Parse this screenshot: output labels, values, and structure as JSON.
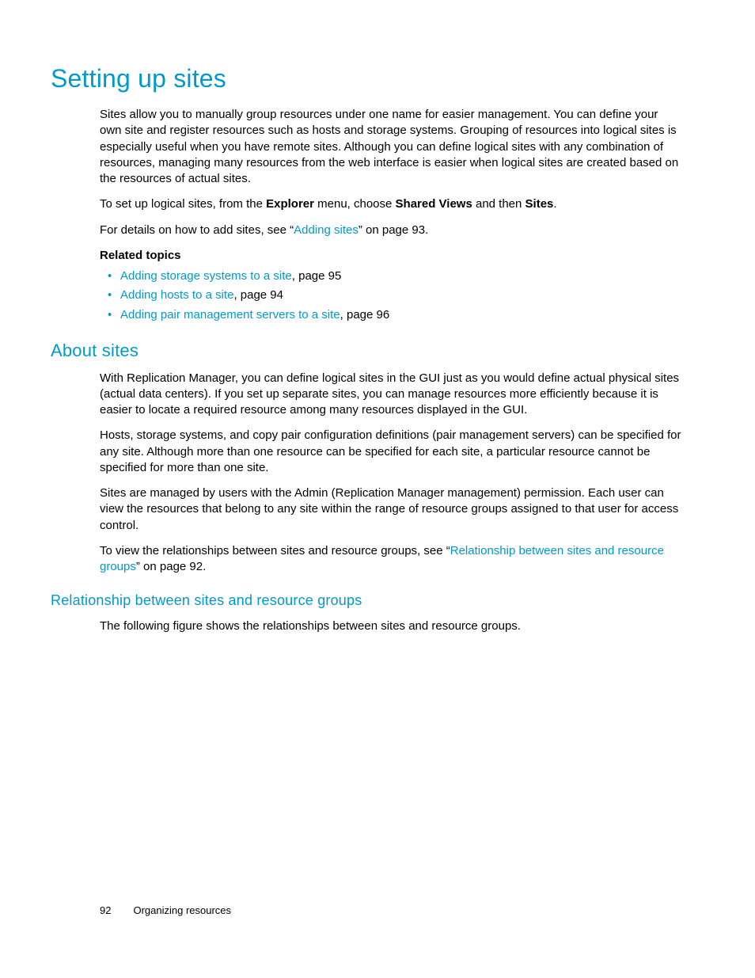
{
  "h1": "Setting up sites",
  "p1_a": "Sites allow you to manually group resources under one name for easier management. You can define your own site and register resources such as hosts and storage systems. Grouping of resources into logical sites is especially useful when you have remote sites. Although you can define logical sites with any combination of resources, managing many resources from the web interface is easier when logical sites are created based on the resources of actual sites.",
  "p2_pre": "To set up logical sites, from the ",
  "p2_b1": "Explorer",
  "p2_mid1": " menu, choose ",
  "p2_b2": "Shared Views",
  "p2_mid2": " and then ",
  "p2_b3": "Sites",
  "p2_end": ".",
  "p3_pre": " For details on how to add sites, see “",
  "p3_link": "Adding sites",
  "p3_post": "” on page 93.",
  "related_heading": "Related topics",
  "rt": [
    {
      "link": "Adding storage systems to a site",
      "rest": ", page 95"
    },
    {
      "link": "Adding hosts to a site",
      "rest": ", page 94"
    },
    {
      "link": "Adding pair management servers to a site",
      "rest": ", page 96"
    }
  ],
  "h2": "About sites",
  "a1": "With Replication Manager, you can define logical sites in the GUI just as you would define actual physical sites (actual data centers). If you set up separate sites, you can manage resources more efficiently because it is easier to locate a required resource among many resources displayed in the GUI.",
  "a2": "Hosts, storage systems, and copy pair configuration definitions (pair management servers) can be specified for any site. Although more than one resource can be specified for each site, a particular resource cannot be specified for more than one site.",
  "a3": "Sites are managed by users with the Admin (Replication Manager management) permission. Each user can view the resources that belong to any site within the range of resource groups assigned to that user for access control.",
  "a4_pre": "To view the relationships between sites and resource groups, see “",
  "a4_link": "Relationship between sites and resource groups",
  "a4_post": "” on page 92.",
  "h3": "Relationship between sites and resource groups",
  "r1": "The following figure shows the relationships between sites and resource groups.",
  "footer_page": "92",
  "footer_title": "Organizing resources"
}
